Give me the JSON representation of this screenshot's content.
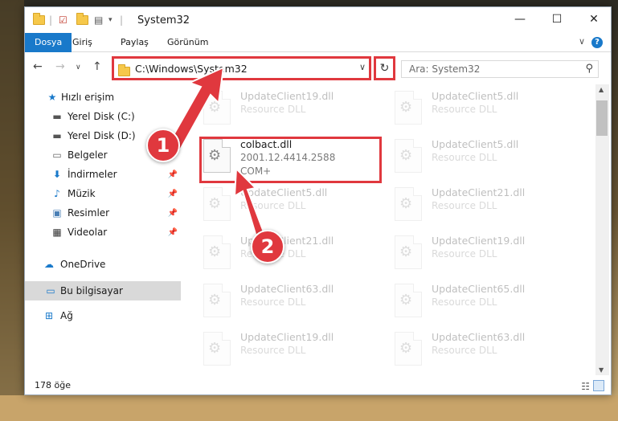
{
  "window": {
    "title": "System32"
  },
  "ribbon": {
    "tabs": [
      "Dosya",
      "Giriş",
      "Paylaş",
      "Görünüm"
    ]
  },
  "address": {
    "path": "C:\\Windows\\System32",
    "search_placeholder": "Ara: System32"
  },
  "sidebar": {
    "items": [
      {
        "label": "Hızlı erişim",
        "icon": "star-icon"
      },
      {
        "label": "Yerel Disk (C:)",
        "icon": "drive-icon"
      },
      {
        "label": "Yerel Disk (D:)",
        "icon": "drive-icon"
      },
      {
        "label": "Belgeler",
        "icon": "documents-icon"
      },
      {
        "label": "İndirmeler",
        "icon": "download-icon"
      },
      {
        "label": "Müzik",
        "icon": "music-icon"
      },
      {
        "label": "Resimler",
        "icon": "pictures-icon"
      },
      {
        "label": "Videolar",
        "icon": "videos-icon"
      },
      {
        "label": "OneDrive",
        "icon": "cloud-icon"
      },
      {
        "label": "Bu bilgisayar",
        "icon": "computer-icon"
      },
      {
        "label": "Ağ",
        "icon": "network-icon"
      }
    ]
  },
  "files": {
    "left": [
      {
        "name": "UpdateClient19.dll",
        "desc": "Resource DLL"
      },
      {
        "name": "colbact.dll",
        "desc": "2001.12.4414.2588",
        "desc2": "COM+"
      },
      {
        "name": "UpdateClient5.dll",
        "desc": "Resource DLL"
      },
      {
        "name": "UpdateClient21.dll",
        "desc": "Resource DLL"
      },
      {
        "name": "UpdateClient63.dll",
        "desc": "Resource DLL"
      },
      {
        "name": "UpdateClient19.dll",
        "desc": "Resource DLL"
      }
    ],
    "right": [
      {
        "name": "UpdateClient5.dll",
        "desc": "Resource DLL"
      },
      {
        "name": "UpdateClient5.dll",
        "desc": "Resource DLL"
      },
      {
        "name": "UpdateClient21.dll",
        "desc": "Resource DLL"
      },
      {
        "name": "UpdateClient19.dll",
        "desc": "Resource DLL"
      },
      {
        "name": "UpdateClient65.dll",
        "desc": "Resource DLL"
      },
      {
        "name": "UpdateClient63.dll",
        "desc": "Resource DLL"
      }
    ]
  },
  "status": {
    "count": "178 öğe"
  },
  "callouts": [
    "1",
    "2"
  ],
  "colors": {
    "accent": "#1979ca",
    "highlight": "#e0383e"
  }
}
